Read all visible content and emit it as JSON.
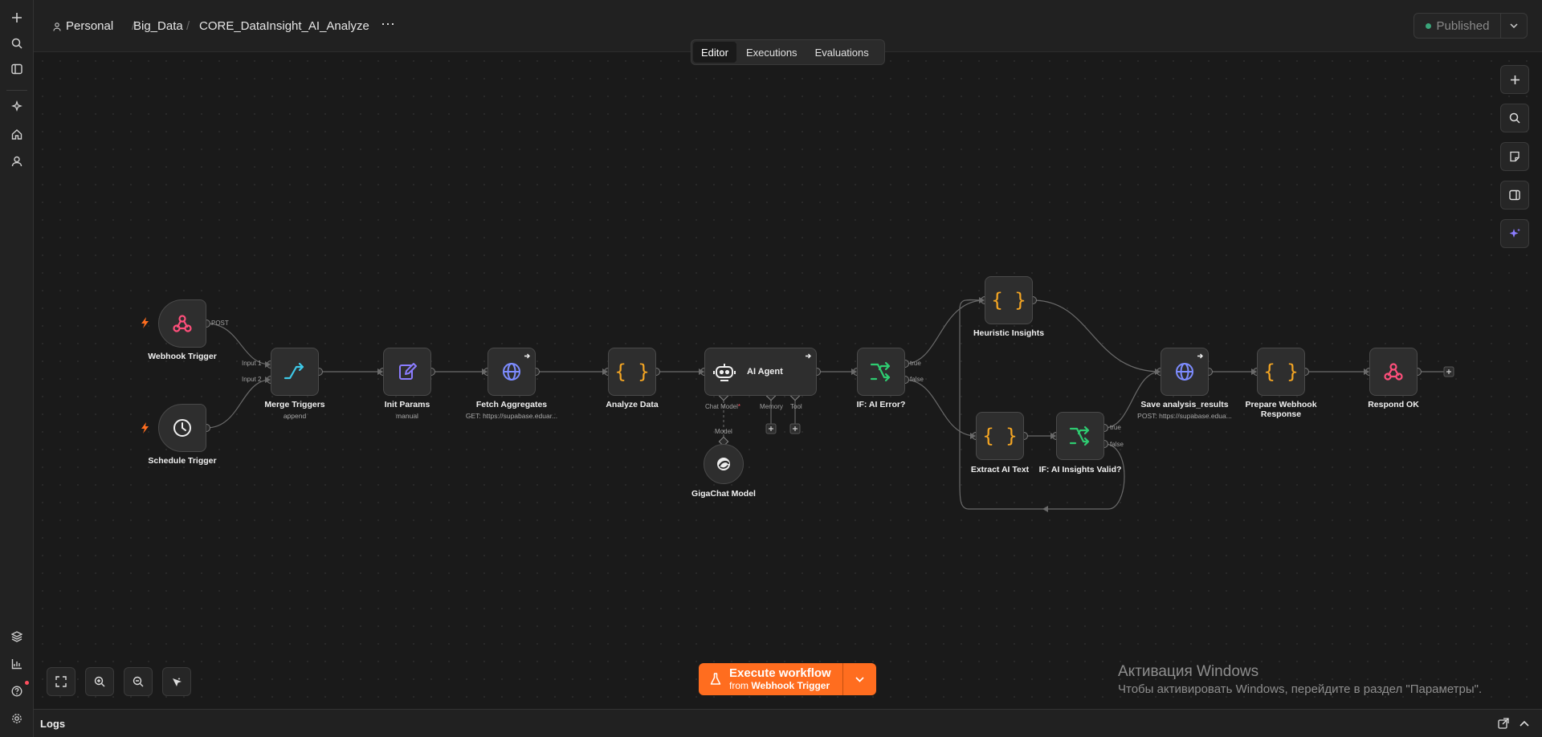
{
  "breadcrumb": {
    "project": "Personal",
    "folder": "Big_Data",
    "workflow": "CORE_DataInsight_AI_Analyze",
    "more": "⋯"
  },
  "header": {
    "status": "Published"
  },
  "tabs": [
    "Editor",
    "Executions",
    "Evaluations"
  ],
  "nodes": {
    "webhook_trigger": {
      "label": "Webhook Trigger",
      "port": "POST"
    },
    "schedule_trigger": {
      "label": "Schedule Trigger"
    },
    "merge_triggers": {
      "label": "Merge Triggers",
      "sub": "append",
      "input1": "Input 1",
      "input2": "Input 2"
    },
    "init_params": {
      "label": "Init Params",
      "sub": "manual"
    },
    "fetch_aggregates": {
      "label": "Fetch Aggregates",
      "sub": "GET: https://supabase.eduar..."
    },
    "analyze_data": {
      "label": "Analyze Data"
    },
    "ai_agent": {
      "label": "AI Agent",
      "chat_model": "Chat Model",
      "required": "*",
      "memory": "Memory",
      "tool": "Tool",
      "model": "Model"
    },
    "gigachat": {
      "label": "GigaChat Model"
    },
    "if_ai_error": {
      "label": "IF: AI Error?",
      "true": "true",
      "false": "false"
    },
    "heuristic": {
      "label": "Heuristic Insights"
    },
    "extract": {
      "label": "Extract AI Text"
    },
    "if_valid": {
      "label": "IF: AI Insights Valid?",
      "true": "true",
      "false": "false"
    },
    "save": {
      "label": "Save analysis_results",
      "sub": "POST: https://supabase.edua..."
    },
    "prepare": {
      "label": "Prepare Webhook",
      "label2": "Response"
    },
    "respond": {
      "label": "Respond OK"
    }
  },
  "execute": {
    "label": "Execute workflow",
    "from_prefix": "from",
    "from_node": "Webhook Trigger"
  },
  "logs": {
    "label": "Logs"
  },
  "watermark": {
    "title": "Активация Windows",
    "text": "Чтобы активировать Windows, перейдите в раздел \"Параметры\"."
  },
  "colors": {
    "accent": "#ff6d1f",
    "webhook": "#ff4f7b",
    "merge": "#3ec9e8",
    "edit": "#8b7cff",
    "http": "#7d8cff",
    "code": "#f5a623",
    "if": "#2ecc71"
  }
}
